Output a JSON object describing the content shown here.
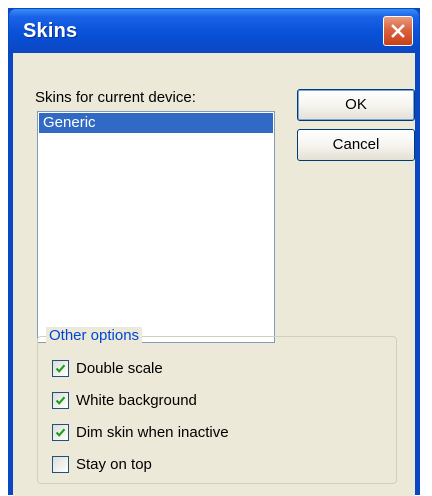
{
  "window": {
    "title": "Skins"
  },
  "skins": {
    "label": "Skins for current device:",
    "items": [
      {
        "label": "Generic",
        "selected": true
      }
    ]
  },
  "buttons": {
    "ok_label": "OK",
    "cancel_label": "Cancel"
  },
  "other_options": {
    "legend": "Other options",
    "options": [
      {
        "label": "Double scale",
        "checked": true
      },
      {
        "label": "White background",
        "checked": true
      },
      {
        "label": "Dim skin when inactive",
        "checked": true
      },
      {
        "label": "Stay on top",
        "checked": false
      }
    ]
  },
  "colors": {
    "titlebar": "#0a47c2",
    "selection": "#316ac5",
    "check_mark": "#21a121",
    "legend_text": "#0046d5",
    "close_button": "#d9643f"
  },
  "icons": {
    "close": "close-icon",
    "check": "checkmark-icon"
  }
}
